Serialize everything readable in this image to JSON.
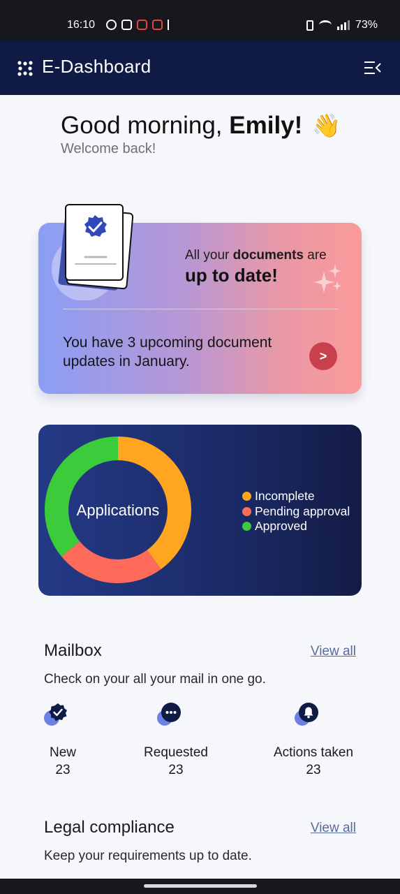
{
  "status_bar": {
    "time": "16:10",
    "battery": "73%",
    "notification_icons": [
      "whatsapp-icon",
      "instagram-icon",
      "app-icon",
      "app-icon",
      "app-icon"
    ]
  },
  "app_bar": {
    "title": "E-Dashboard",
    "logo_icon": "dots-logo-icon",
    "menu_icon": "menu-collapse-icon"
  },
  "greeting": {
    "prefix": "Good morning, ",
    "name": "Emily!",
    "emoji": "👋",
    "welcome": "Welcome back!"
  },
  "documents_card": {
    "line1_prefix": "All your ",
    "line1_bold": "documents",
    "line1_suffix": " are",
    "line2": "up to date!",
    "updates_text": "You have 3 upcoming document updates in January.",
    "go_button_label": ">"
  },
  "applications_card": {
    "center_label": "Applications",
    "chart_data": {
      "type": "pie",
      "title": "Applications",
      "series": [
        {
          "name": "Incomplete",
          "value": 40,
          "color": "#FFA51F"
        },
        {
          "name": "Pending approval",
          "value": 24,
          "color": "#FF6B5A"
        },
        {
          "name": "Approved",
          "value": 36,
          "color": "#3CCB3A"
        }
      ],
      "legend_position": "right"
    }
  },
  "mailbox": {
    "title": "Mailbox",
    "view_all": "View all",
    "subtitle": "Check on your all your mail in one go.",
    "stats": [
      {
        "label": "New",
        "count": "23",
        "icon": "verified-badge-icon"
      },
      {
        "label": "Requested",
        "count": "23",
        "icon": "chat-dots-icon"
      },
      {
        "label": "Actions taken",
        "count": "23",
        "icon": "bell-icon"
      }
    ]
  },
  "legal": {
    "title": "Legal compliance",
    "view_all": "View all",
    "subtitle": "Keep your requirements up to date."
  },
  "colors": {
    "app_bar": "#0F1B45",
    "go_button": "#C9404D",
    "link": "#5A6AA0"
  }
}
